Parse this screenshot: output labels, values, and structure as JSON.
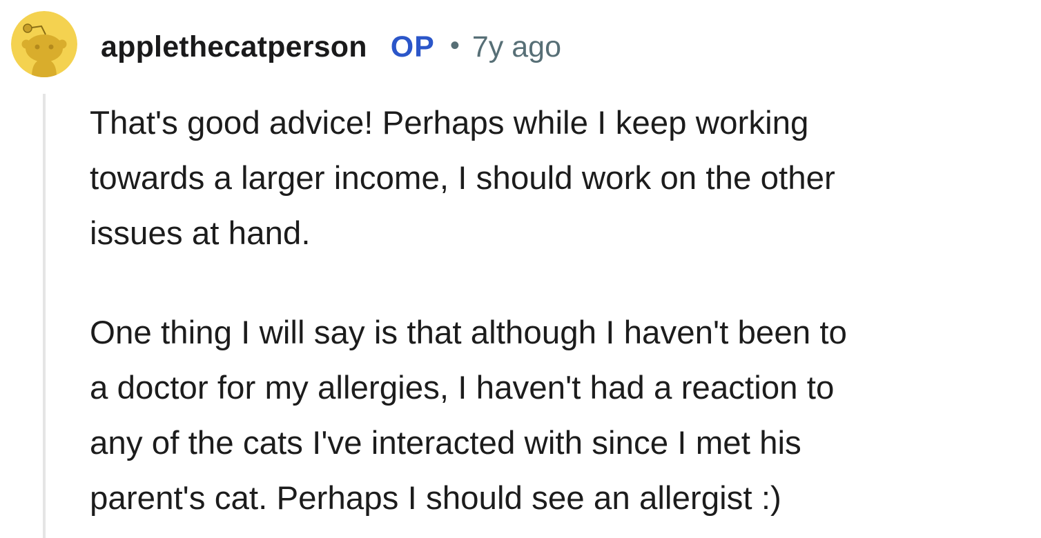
{
  "comment": {
    "author": {
      "username": "applethecatperson",
      "badge": "OP",
      "avatar_icon": "snoo-avatar-icon",
      "avatar_color": "#f4d250"
    },
    "separator": "•",
    "timestamp": "7y ago",
    "body": {
      "paragraph_1": "That's good advice! Perhaps while I keep working\ntowards a larger income, I should work on the other\nissues at hand.",
      "paragraph_2": "One thing I will say is that although I haven't been to\na doctor for my allergies, I haven't had a reaction to\nany of the cats I've interacted with since I met his\nparent's cat. Perhaps I should see an allergist :)"
    },
    "colors": {
      "op_badge": "#2b56c9",
      "meta_text": "#576f76",
      "thread_line": "#e5e5e5"
    }
  }
}
